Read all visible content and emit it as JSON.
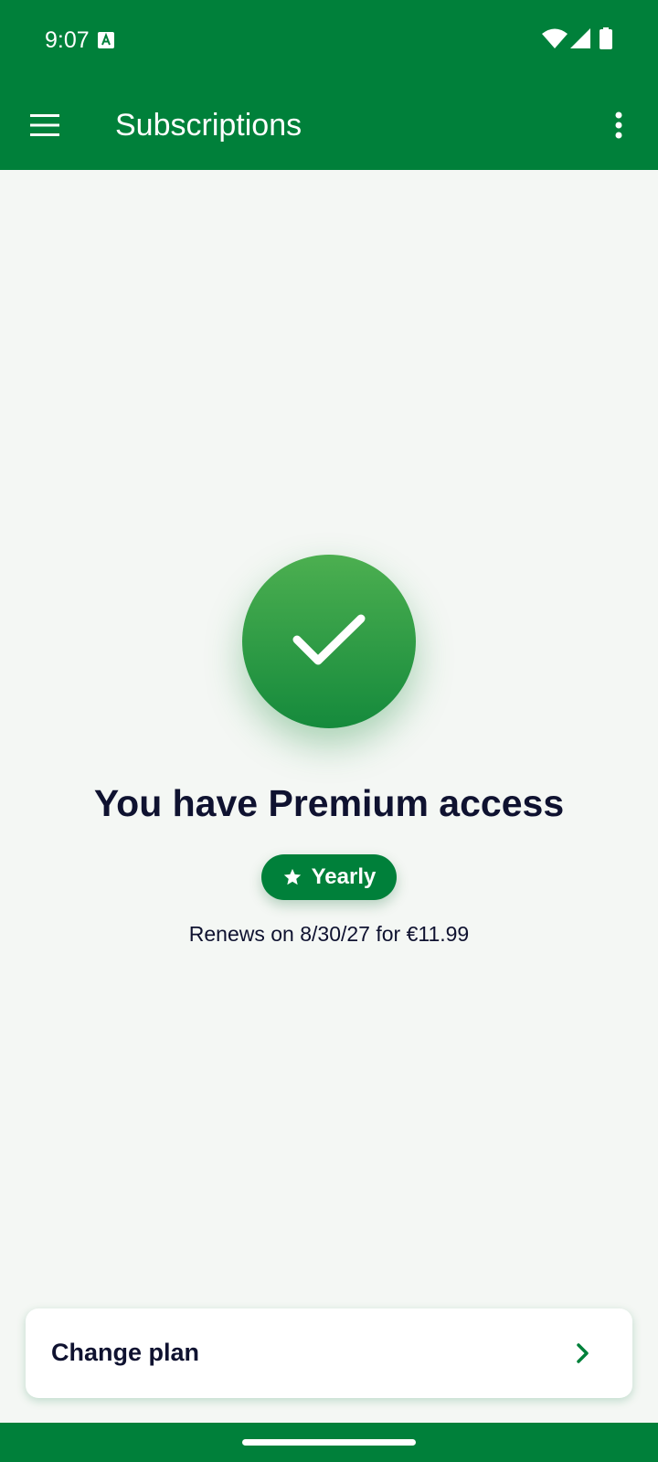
{
  "status_bar": {
    "time": "9:07",
    "icons": [
      "a-notification-icon",
      "wifi-icon",
      "signal-icon",
      "battery-icon"
    ]
  },
  "app_bar": {
    "title": "Subscriptions",
    "menu_icon": "hamburger-menu-icon",
    "overflow_icon": "more-vert-icon"
  },
  "main": {
    "status_icon": "check-icon",
    "headline": "You have Premium access",
    "plan_badge": {
      "icon": "star-icon",
      "label": "Yearly"
    },
    "renewal_text": "Renews on 8/30/27 for €11.99"
  },
  "actions": {
    "change_plan_label": "Change plan",
    "chevron_icon": "chevron-right-icon"
  },
  "colors": {
    "primary": "#00803a",
    "background": "#f4f7f4",
    "text": "#0f1230",
    "check_gradient_top": "#4caf50",
    "check_gradient_bottom": "#158a3c"
  }
}
